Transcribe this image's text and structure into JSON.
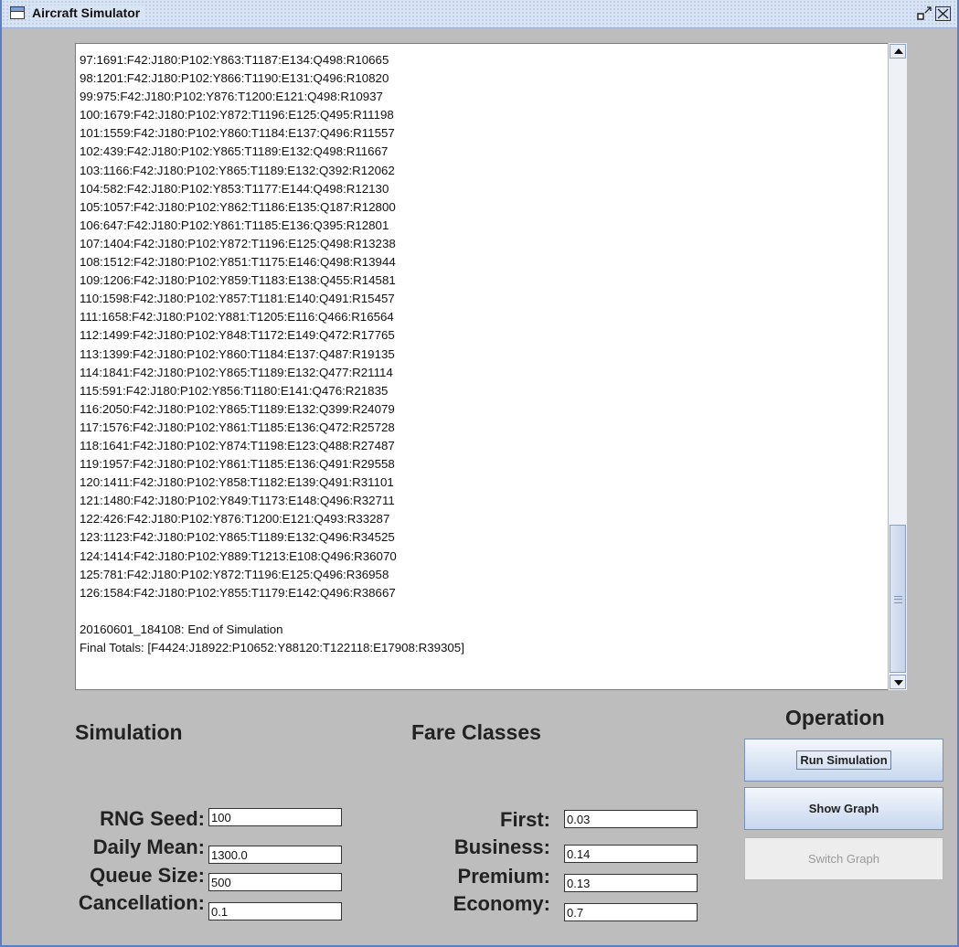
{
  "window": {
    "title": "Aircraft Simulator",
    "restore_glyph": "▫⤡",
    "close_glyph": "✕"
  },
  "log": {
    "lines": [
      "97:1691:F42:J180:P102:Y863:T1187:E134:Q498:R10665",
      "98:1201:F42:J180:P102:Y866:T1190:E131:Q496:R10820",
      "99:975:F42:J180:P102:Y876:T1200:E121:Q498:R10937",
      "100:1679:F42:J180:P102:Y872:T1196:E125:Q495:R11198",
      "101:1559:F42:J180:P102:Y860:T1184:E137:Q496:R11557",
      "102:439:F42:J180:P102:Y865:T1189:E132:Q498:R11667",
      "103:1166:F42:J180:P102:Y865:T1189:E132:Q392:R12062",
      "104:582:F42:J180:P102:Y853:T1177:E144:Q498:R12130",
      "105:1057:F42:J180:P102:Y862:T1186:E135:Q187:R12800",
      "106:647:F42:J180:P102:Y861:T1185:E136:Q395:R12801",
      "107:1404:F42:J180:P102:Y872:T1196:E125:Q498:R13238",
      "108:1512:F42:J180:P102:Y851:T1175:E146:Q498:R13944",
      "109:1206:F42:J180:P102:Y859:T1183:E138:Q455:R14581",
      "110:1598:F42:J180:P102:Y857:T1181:E140:Q491:R15457",
      "111:1658:F42:J180:P102:Y881:T1205:E116:Q466:R16564",
      "112:1499:F42:J180:P102:Y848:T1172:E149:Q472:R17765",
      "113:1399:F42:J180:P102:Y860:T1184:E137:Q487:R19135",
      "114:1841:F42:J180:P102:Y865:T1189:E132:Q477:R21114",
      "115:591:F42:J180:P102:Y856:T1180:E141:Q476:R21835",
      "116:2050:F42:J180:P102:Y865:T1189:E132:Q399:R24079",
      "117:1576:F42:J180:P102:Y861:T1185:E136:Q472:R25728",
      "118:1641:F42:J180:P102:Y874:T1198:E123:Q488:R27487",
      "119:1957:F42:J180:P102:Y861:T1185:E136:Q491:R29558",
      "120:1411:F42:J180:P102:Y858:T1182:E139:Q491:R31101",
      "121:1480:F42:J180:P102:Y849:T1173:E148:Q496:R32711",
      "122:426:F42:J180:P102:Y876:T1200:E121:Q493:R33287",
      "123:1123:F42:J180:P102:Y865:T1189:E132:Q496:R34525",
      "124:1414:F42:J180:P102:Y889:T1213:E108:Q496:R36070",
      "125:781:F42:J180:P102:Y872:T1196:E125:Q496:R36958",
      "126:1584:F42:J180:P102:Y855:T1179:E142:Q496:R38667",
      "",
      "20160601_184108: End of Simulation",
      "Final Totals: [F4424:J18922:P10652:Y88120:T122118:E17908:R39305]"
    ]
  },
  "simulation": {
    "heading": "Simulation",
    "rng_seed": {
      "label": "RNG Seed:",
      "value": "100"
    },
    "daily_mean": {
      "label": "Daily Mean:",
      "value": "1300.0"
    },
    "queue_size": {
      "label": "Queue Size:",
      "value": "500"
    },
    "cancellation": {
      "label": "Cancellation:",
      "value": "0.1"
    }
  },
  "fare_classes": {
    "heading": "Fare Classes",
    "first": {
      "label": "First:",
      "value": "0.03"
    },
    "business": {
      "label": "Business:",
      "value": "0.14"
    },
    "premium": {
      "label": "Premium:",
      "value": "0.13"
    },
    "economy": {
      "label": "Economy:",
      "value": "0.7"
    }
  },
  "operation": {
    "heading": "Operation",
    "run_label": "Run Simulation",
    "graph_label": "Show Graph",
    "switch_label": "Switch Graph"
  }
}
